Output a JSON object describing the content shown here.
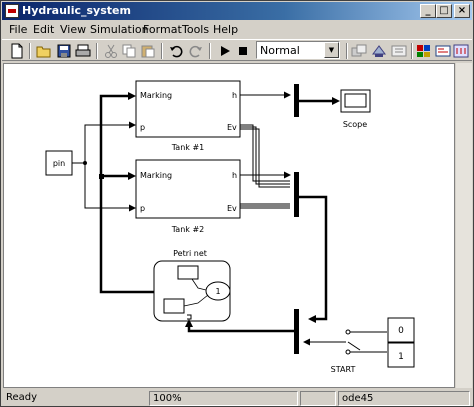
{
  "window": {
    "title": "Hydraulic_system"
  },
  "title_buttons": {
    "minimize": "_",
    "maximize": "□",
    "close": "×"
  },
  "menu": [
    "File",
    "Edit",
    "View",
    "Simulation",
    "Format",
    "Tools",
    "Help"
  ],
  "toolbar": {
    "sim_mode": "Normal"
  },
  "diagram": {
    "source_block": "pin",
    "tank1": {
      "name": "Tank #1",
      "in_marking": "Marking",
      "in_p": "p",
      "out_h": "h",
      "out_ev": "Ev"
    },
    "tank2": {
      "name": "Tank #2",
      "in_marking": "Marking",
      "in_p": "p",
      "out_h": "h",
      "out_ev": "Ev"
    },
    "scope": "Scope",
    "petri": {
      "name": "Petri net",
      "place_label": "1"
    },
    "const0": "0",
    "const1": "1",
    "switch_label": "START"
  },
  "status": {
    "state": "Ready",
    "zoom": "100%",
    "solver": "ode45"
  },
  "colors": {
    "title_start": "#0a246a",
    "title_end": "#a6caf0",
    "chrome": "#d4d0c8"
  }
}
